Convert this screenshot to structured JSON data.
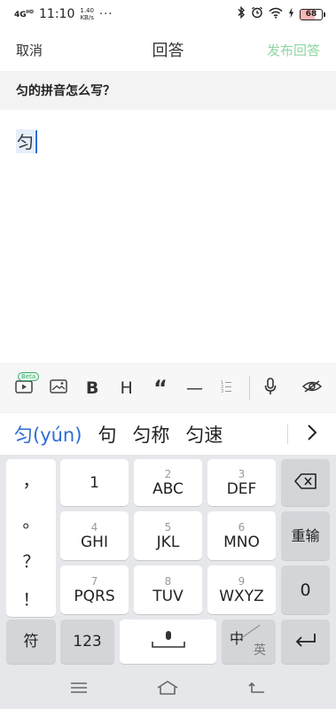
{
  "status_bar": {
    "network": "4G",
    "network_sup": "HD",
    "time": "11:10",
    "speed_value": "1.40",
    "speed_unit": "KB/s",
    "dots": "···",
    "battery_level": "68",
    "battery_fraction": 0.68
  },
  "header": {
    "cancel_label": "取消",
    "title": "回答",
    "publish_label": "发布回答",
    "publish_color": "#8fd6a3"
  },
  "question": {
    "text": "匀的拼音怎么写？"
  },
  "editor": {
    "composing_text": "匀"
  },
  "toolbar": {
    "beta_badge": "Beta",
    "items": [
      "video-icon",
      "image-icon",
      "bold",
      "heading",
      "quote",
      "divider",
      "list-icon",
      "microphone-icon",
      "hide-keyboard-icon"
    ],
    "bold_label": "B",
    "heading_label": "H",
    "quote_label": "“",
    "divider_label": "—"
  },
  "candidates": {
    "items": [
      "匀(yún)",
      "句",
      "匀称",
      "匀速"
    ],
    "highlight_color": "#2b6bd6"
  },
  "keyboard": {
    "punctuation": [
      "，",
      "。",
      "？",
      "！"
    ],
    "keys_row1": [
      {
        "num": "",
        "label": "1"
      },
      {
        "num": "2",
        "label": "ABC"
      },
      {
        "num": "3",
        "label": "DEF"
      }
    ],
    "keys_row2": [
      {
        "num": "4",
        "label": "GHI"
      },
      {
        "num": "5",
        "label": "JKL"
      },
      {
        "num": "6",
        "label": "MNO"
      }
    ],
    "keys_row3": [
      {
        "num": "7",
        "label": "PQRS"
      },
      {
        "num": "8",
        "label": "TUV"
      },
      {
        "num": "9",
        "label": "WXYZ"
      }
    ],
    "retype_label": "重输",
    "zero_label": "0",
    "symbol_label": "符",
    "numbers_label": "123",
    "lang_primary": "中",
    "lang_secondary": "英"
  }
}
